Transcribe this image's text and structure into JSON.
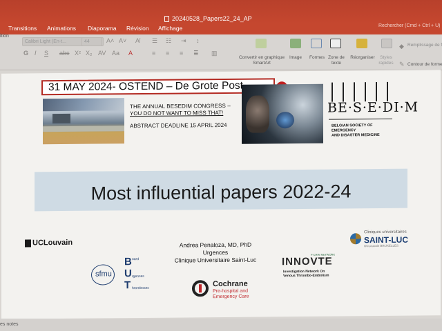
{
  "window": {
    "filename": "20240528_Papers22_24_AP",
    "search_hint": "Rechercher (Cmd + Ctrl + U)"
  },
  "tabs": [
    "Transitions",
    "Animations",
    "Diaporama",
    "Révision",
    "Affichage"
  ],
  "toolbar": {
    "left_label": "ition",
    "font_name": "Calibri Light (En-t...",
    "font_size": "44",
    "smartart_label": "Convertir en graphique SmartArt",
    "image_label": "Image",
    "shapes_label": "Formes",
    "textbox_label": "Zone de texte",
    "arrange_label": "Réorganiser",
    "styles_label": "Styles rapides",
    "fill_label": "Remplissage de forme",
    "outline_label": "Contour de forme"
  },
  "slide": {
    "banner": {
      "date_line": "31 MAY 2024- OSTEND – De Grote Post",
      "congress_line1": "THE ANNUAL BESEDIM CONGRESS –",
      "congress_line2": "YOU DO NOT WANT TO MISS THAT!",
      "deadline": "ABSTRACT DEADLINE 15 APRIL 2024",
      "besedim_name": "BE·S·E·DI·M",
      "besedim_sub1": "BELGIAN SOCIETY OF EMERGENCY",
      "besedim_sub2": "AND DISASTER MEDICINE"
    },
    "title": "Most influential papers 2022-24",
    "author": {
      "name": "Andrea Penaloza, MD, PhD",
      "department": "Urgences",
      "institution": "Clinique Universitaire Saint-Luc"
    },
    "logos": {
      "uclouvain": "UCLouvain",
      "stluc_top": "Cliniques universitaires",
      "stluc_name": "SAINT-LUC",
      "stluc_sub": "UCLouvain BRUXELLES",
      "sfmu": "sfmu",
      "but_b": "B",
      "but_b_word": "oard",
      "but_u": "U",
      "but_u_word": "rgences",
      "but_t": "T",
      "but_t_word": "hromboses",
      "innovte": "INNOVTE",
      "innovte_tag": "F-CRIN NETWORK",
      "innovte_sub1": "Investigation Network On",
      "innovte_sub2": "Venous Thrombo-Embolism",
      "cochrane": "Cochrane",
      "cochrane_sub1": "Pre-hospital and",
      "cochrane_sub2": "Emergency Care"
    }
  },
  "status": {
    "notes": "es notes"
  },
  "colors": {
    "ribbon": "#c5472f",
    "banner_border": "#b32a22",
    "title_band": "#cfdbe4"
  }
}
